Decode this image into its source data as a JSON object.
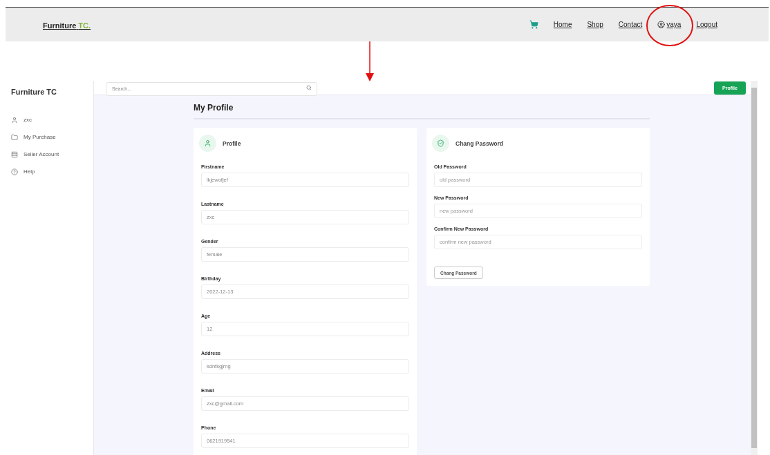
{
  "navbar": {
    "brand": {
      "name": "Furniture",
      "accent": "TC."
    },
    "items": [
      {
        "kind": "cart"
      },
      {
        "kind": "link",
        "label": "Home"
      },
      {
        "kind": "link",
        "label": "Shop"
      },
      {
        "kind": "link",
        "label": "Contact"
      },
      {
        "kind": "user",
        "label": "yaya"
      },
      {
        "kind": "link",
        "label": "Logout"
      }
    ]
  },
  "app": {
    "brand": "Furniture TC",
    "sidebar": {
      "items": [
        {
          "kind": "user",
          "label": "zxc"
        },
        {
          "kind": "folder",
          "label": "My Purchase"
        },
        {
          "kind": "list",
          "label": "Seller Account"
        },
        {
          "kind": "help",
          "label": "Help"
        }
      ]
    },
    "search": {
      "placeholder": "Search..."
    },
    "profile_button": "Profile",
    "title": "My Profile",
    "profile_card": {
      "title": "Profile",
      "fields": [
        {
          "label": "Firstname",
          "value": "lkjewofjef"
        },
        {
          "label": "Lastname",
          "value": "zxc"
        },
        {
          "label": "Gender",
          "value": "female"
        },
        {
          "label": "Birthday",
          "value": "2022-12-13"
        },
        {
          "label": "Age",
          "value": "12"
        },
        {
          "label": "Address",
          "value": "kdnfkgjrng"
        },
        {
          "label": "Email",
          "value": "zxc@gmail.com"
        },
        {
          "label": "Phone",
          "value": "0621919541"
        }
      ]
    },
    "password_card": {
      "title": "Chang Password",
      "fields": [
        {
          "label": "Old Password",
          "placeholder": "old password"
        },
        {
          "label": "New Password",
          "placeholder": "new password"
        },
        {
          "label": "Confirm New Password",
          "placeholder": "confirm new password"
        }
      ],
      "button": "Chang Password"
    }
  }
}
